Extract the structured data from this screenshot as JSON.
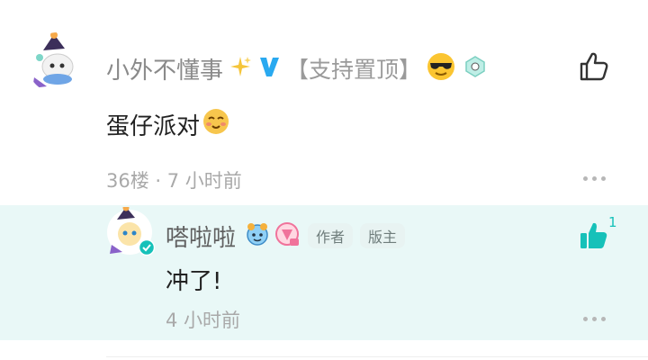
{
  "comment": {
    "username": "小外不懂事",
    "bracket_tag": "【支持置顶】",
    "text": "蛋仔派对",
    "meta": "36楼 · 7 小时前",
    "icons": [
      "sparkle-icon",
      "verified-v-icon",
      "sunglasses-emoji-icon",
      "level-badge-icon",
      "thumbs-up-icon",
      "more-icon"
    ]
  },
  "reply": {
    "username": "嗒啦啦",
    "tags": [
      "作者",
      "版主"
    ],
    "text": "冲了!",
    "meta": "4 小时前",
    "like_count": "1",
    "icons": [
      "blue-bear-badge-icon",
      "pink-rank-badge-icon",
      "thumbs-up-filled-icon",
      "more-icon",
      "verified-check-icon"
    ]
  },
  "colors": {
    "reply_bg": "#e9f8f7",
    "accent": "#16c1b9",
    "verified_blue": "#29a9f0"
  }
}
